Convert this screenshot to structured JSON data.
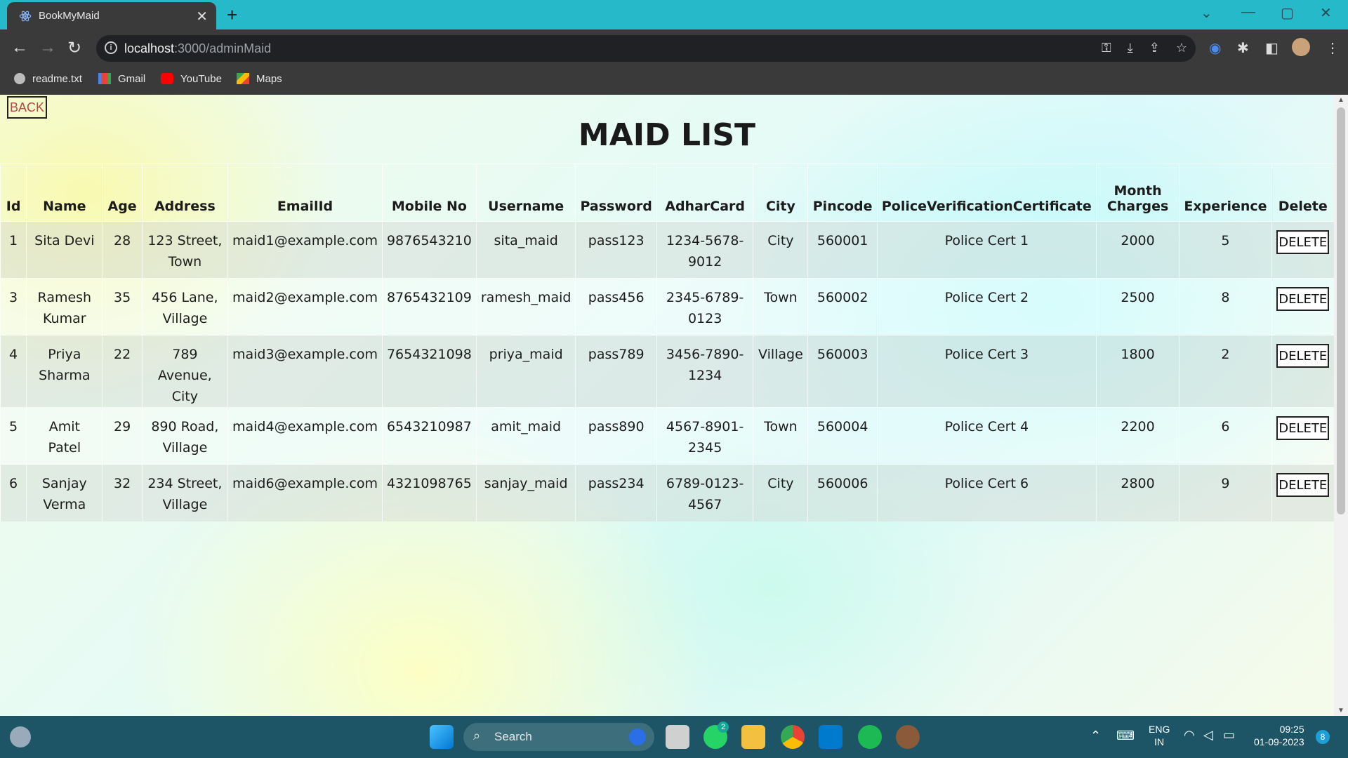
{
  "browser": {
    "tab_title": "BookMyMaid",
    "tab_close": "✕",
    "new_tab": "+",
    "url_host": "localhost",
    "url_path": ":3000/adminMaid",
    "bookmarks": [
      "readme.txt",
      "Gmail",
      "YouTube",
      "Maps"
    ]
  },
  "page": {
    "back_label": "BACK",
    "title": "MAID LIST",
    "delete_label": "DELETE",
    "columns": [
      "Id",
      "Name",
      "Age",
      "Address",
      "EmailId",
      "Mobile No",
      "Username",
      "Password",
      "AdharCard",
      "City",
      "Pincode",
      "PoliceVerificationCertificate",
      "Month Charges",
      "Experience",
      "Delete"
    ],
    "rows": [
      {
        "id": "1",
        "name": "Sita Devi",
        "age": "28",
        "address": "123 Street, Town",
        "email": "maid1@example.com",
        "mobile": "9876543210",
        "username": "sita_maid",
        "password": "pass123",
        "adhar": "1234-5678-9012",
        "city": "City",
        "pincode": "560001",
        "police": "Police Cert 1",
        "charges": "2000",
        "experience": "5"
      },
      {
        "id": "3",
        "name": "Ramesh Kumar",
        "age": "35",
        "address": "456 Lane, Village",
        "email": "maid2@example.com",
        "mobile": "8765432109",
        "username": "ramesh_maid",
        "password": "pass456",
        "adhar": "2345-6789-0123",
        "city": "Town",
        "pincode": "560002",
        "police": "Police Cert 2",
        "charges": "2500",
        "experience": "8"
      },
      {
        "id": "4",
        "name": "Priya Sharma",
        "age": "22",
        "address": "789 Avenue, City",
        "email": "maid3@example.com",
        "mobile": "7654321098",
        "username": "priya_maid",
        "password": "pass789",
        "adhar": "3456-7890-1234",
        "city": "Village",
        "pincode": "560003",
        "police": "Police Cert 3",
        "charges": "1800",
        "experience": "2"
      },
      {
        "id": "5",
        "name": "Amit Patel",
        "age": "29",
        "address": "890 Road, Village",
        "email": "maid4@example.com",
        "mobile": "6543210987",
        "username": "amit_maid",
        "password": "pass890",
        "adhar": "4567-8901-2345",
        "city": "Town",
        "pincode": "560004",
        "police": "Police Cert 4",
        "charges": "2200",
        "experience": "6"
      },
      {
        "id": "6",
        "name": "Sanjay Verma",
        "age": "32",
        "address": "234 Street, Village",
        "email": "maid6@example.com",
        "mobile": "4321098765",
        "username": "sanjay_maid",
        "password": "pass234",
        "adhar": "6789-0123-4567",
        "city": "City",
        "pincode": "560006",
        "police": "Police Cert 6",
        "charges": "2800",
        "experience": "9"
      }
    ]
  },
  "taskbar": {
    "search_label": "Search",
    "whatsapp_badge": "2",
    "lang_top": "ENG",
    "lang_bottom": "IN",
    "time": "09:25",
    "date": "01-09-2023",
    "notif_count": "8"
  },
  "colors": {
    "tabstrip": "#25b9c9",
    "chrome": "#3a3a3a",
    "taskbar": "#1e5566"
  }
}
